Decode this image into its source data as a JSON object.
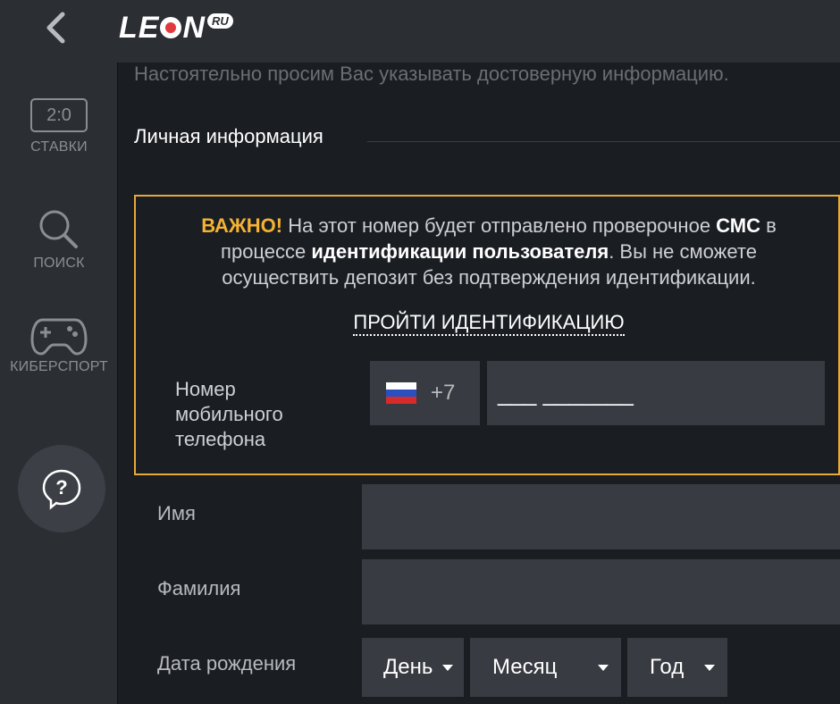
{
  "header": {
    "logo_text": "LE",
    "logo_text_end": "N",
    "logo_badge": "RU"
  },
  "sidebar": {
    "items": [
      {
        "label": "СТАВКИ",
        "icon": "score-icon",
        "score": "2:0"
      },
      {
        "label": "ПОИСК",
        "icon": "search-icon"
      },
      {
        "label": "КИБЕРСПОРТ",
        "icon": "gamepad-icon"
      }
    ],
    "help_icon": "help-icon"
  },
  "form": {
    "notice": "Настоятельно просим Вас указывать достоверную информацию.",
    "section_title": "Личная информация",
    "important": {
      "warn": "ВАЖНО!",
      "text1": " На этот номер будет отправлено проверочное ",
      "bold1": "СМС",
      "text2": " в процессе ",
      "bold2": "идентификации пользователя",
      "text3": ". Вы не сможете осуществить депозит без подтверждения идентификации."
    },
    "verify_link": "ПРОЙТИ ИДЕНТИФИКАЦИЮ",
    "phone_label": "Номер мобильного телефона",
    "country_code": "+7",
    "phone_mask": "___ _______",
    "first_name_label": "Имя",
    "last_name_label": "Фамилия",
    "birth_label": "Дата рождения",
    "day_placeholder": "День",
    "month_placeholder": "Месяц",
    "year_placeholder": "Год"
  },
  "colors": {
    "accent": "#f4b233",
    "panel": "#2b2e33",
    "input": "#383b41",
    "bg": "#1a1d22"
  }
}
